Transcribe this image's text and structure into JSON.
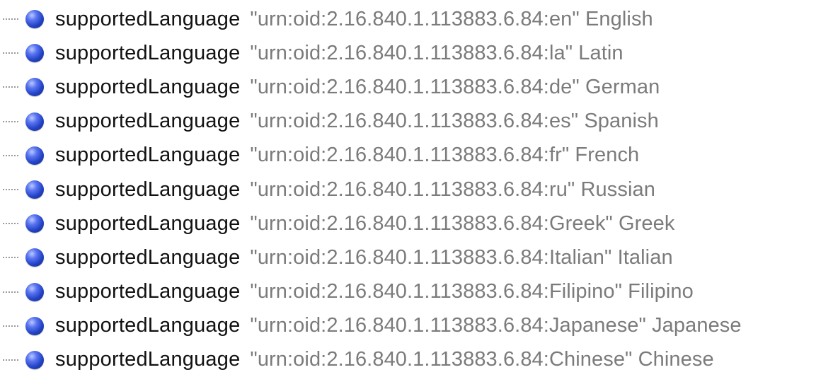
{
  "tree": {
    "items": [
      {
        "name": "supportedLanguage",
        "value": "\"urn:oid:2.16.840.1.113883.6.84:en\" English"
      },
      {
        "name": "supportedLanguage",
        "value": "\"urn:oid:2.16.840.1.113883.6.84:la\" Latin"
      },
      {
        "name": "supportedLanguage",
        "value": "\"urn:oid:2.16.840.1.113883.6.84:de\" German"
      },
      {
        "name": "supportedLanguage",
        "value": "\"urn:oid:2.16.840.1.113883.6.84:es\" Spanish"
      },
      {
        "name": "supportedLanguage",
        "value": "\"urn:oid:2.16.840.1.113883.6.84:fr\" French"
      },
      {
        "name": "supportedLanguage",
        "value": "\"urn:oid:2.16.840.1.113883.6.84:ru\" Russian"
      },
      {
        "name": "supportedLanguage",
        "value": "\"urn:oid:2.16.840.1.113883.6.84:Greek\" Greek"
      },
      {
        "name": "supportedLanguage",
        "value": "\"urn:oid:2.16.840.1.113883.6.84:Italian\" Italian"
      },
      {
        "name": "supportedLanguage",
        "value": "\"urn:oid:2.16.840.1.113883.6.84:Filipino\" Filipino"
      },
      {
        "name": "supportedLanguage",
        "value": "\"urn:oid:2.16.840.1.113883.6.84:Japanese\" Japanese"
      },
      {
        "name": "supportedLanguage",
        "value": "\"urn:oid:2.16.840.1.113883.6.84:Chinese\" Chinese"
      }
    ],
    "icon": "blue-sphere-icon",
    "colors": {
      "name_text": "#111111",
      "value_text": "#7b7b7b",
      "icon": "#2344c8"
    }
  }
}
